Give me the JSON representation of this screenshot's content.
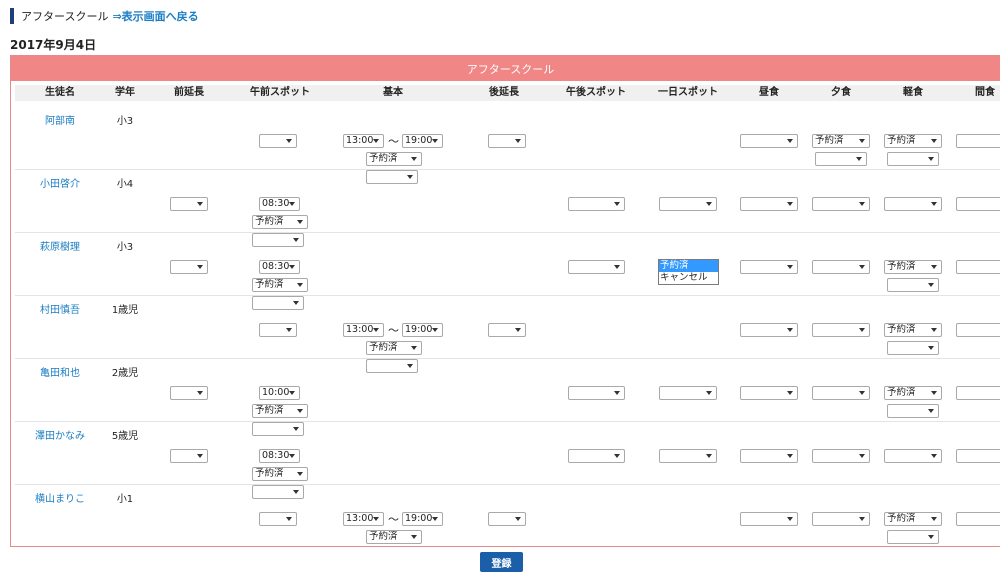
{
  "breadcrumb": {
    "title": "アフタースクール",
    "back_link": "⇒表示画面へ戻る"
  },
  "date": "2017年9月4日",
  "panel_title": "アフタースクール",
  "columns": [
    {
      "key": "name",
      "label": "生徒名"
    },
    {
      "key": "grade",
      "label": "学年"
    },
    {
      "key": "pre_ext",
      "label": "前延長"
    },
    {
      "key": "am_spot",
      "label": "午前スポット"
    },
    {
      "key": "basic",
      "label": "基本"
    },
    {
      "key": "post_ext",
      "label": "後延長"
    },
    {
      "key": "pm_spot",
      "label": "午後スポット"
    },
    {
      "key": "day_spot",
      "label": "一日スポット"
    },
    {
      "key": "lunch",
      "label": "昼食"
    },
    {
      "key": "dinner",
      "label": "夕食"
    },
    {
      "key": "snack",
      "label": "軽食"
    },
    {
      "key": "snack2",
      "label": "間食"
    }
  ],
  "rows": [
    {
      "name": "阿部南",
      "grade": "小3",
      "type": "basic",
      "time_from": "13:00",
      "time_to": "19:00",
      "status": "予約済",
      "sub": "",
      "dinner": "予約済",
      "snack": "予約済"
    },
    {
      "name": "小田啓介",
      "grade": "小4",
      "type": "spot",
      "spot_time": "08:30",
      "status": "予約済",
      "sub": "",
      "dinner": "",
      "snack": ""
    },
    {
      "name": "萩原樹理",
      "grade": "小3",
      "type": "spot",
      "spot_time": "08:30",
      "status": "予約済",
      "sub": "",
      "dinner": "",
      "snack": "予約済"
    },
    {
      "name": "村田慎吾",
      "grade": "1歳児",
      "type": "basic",
      "time_from": "13:00",
      "time_to": "19:00",
      "status": "予約済",
      "sub": "",
      "dinner": "",
      "snack": "予約済"
    },
    {
      "name": "亀田和也",
      "grade": "2歳児",
      "type": "spot",
      "spot_time": "10:00",
      "status": "予約済",
      "sub": "",
      "dinner": "",
      "snack": "予約済"
    },
    {
      "name": "澤田かなみ",
      "grade": "5歳児",
      "type": "spot",
      "spot_time": "08:30",
      "status": "予約済",
      "sub": "",
      "dinner": "",
      "snack": ""
    },
    {
      "name": "横山まりこ",
      "grade": "小1",
      "type": "basic",
      "time_from": "13:00",
      "time_to": "19:00",
      "status": "予約済",
      "sub": "",
      "dinner": "",
      "snack": "予約済"
    }
  ],
  "tilde": "〜",
  "open_dropdown": {
    "row": 2,
    "column": "day_spot",
    "options": [
      "予約済",
      "キャンセル"
    ],
    "highlighted": 0
  },
  "submit_label": "登録"
}
